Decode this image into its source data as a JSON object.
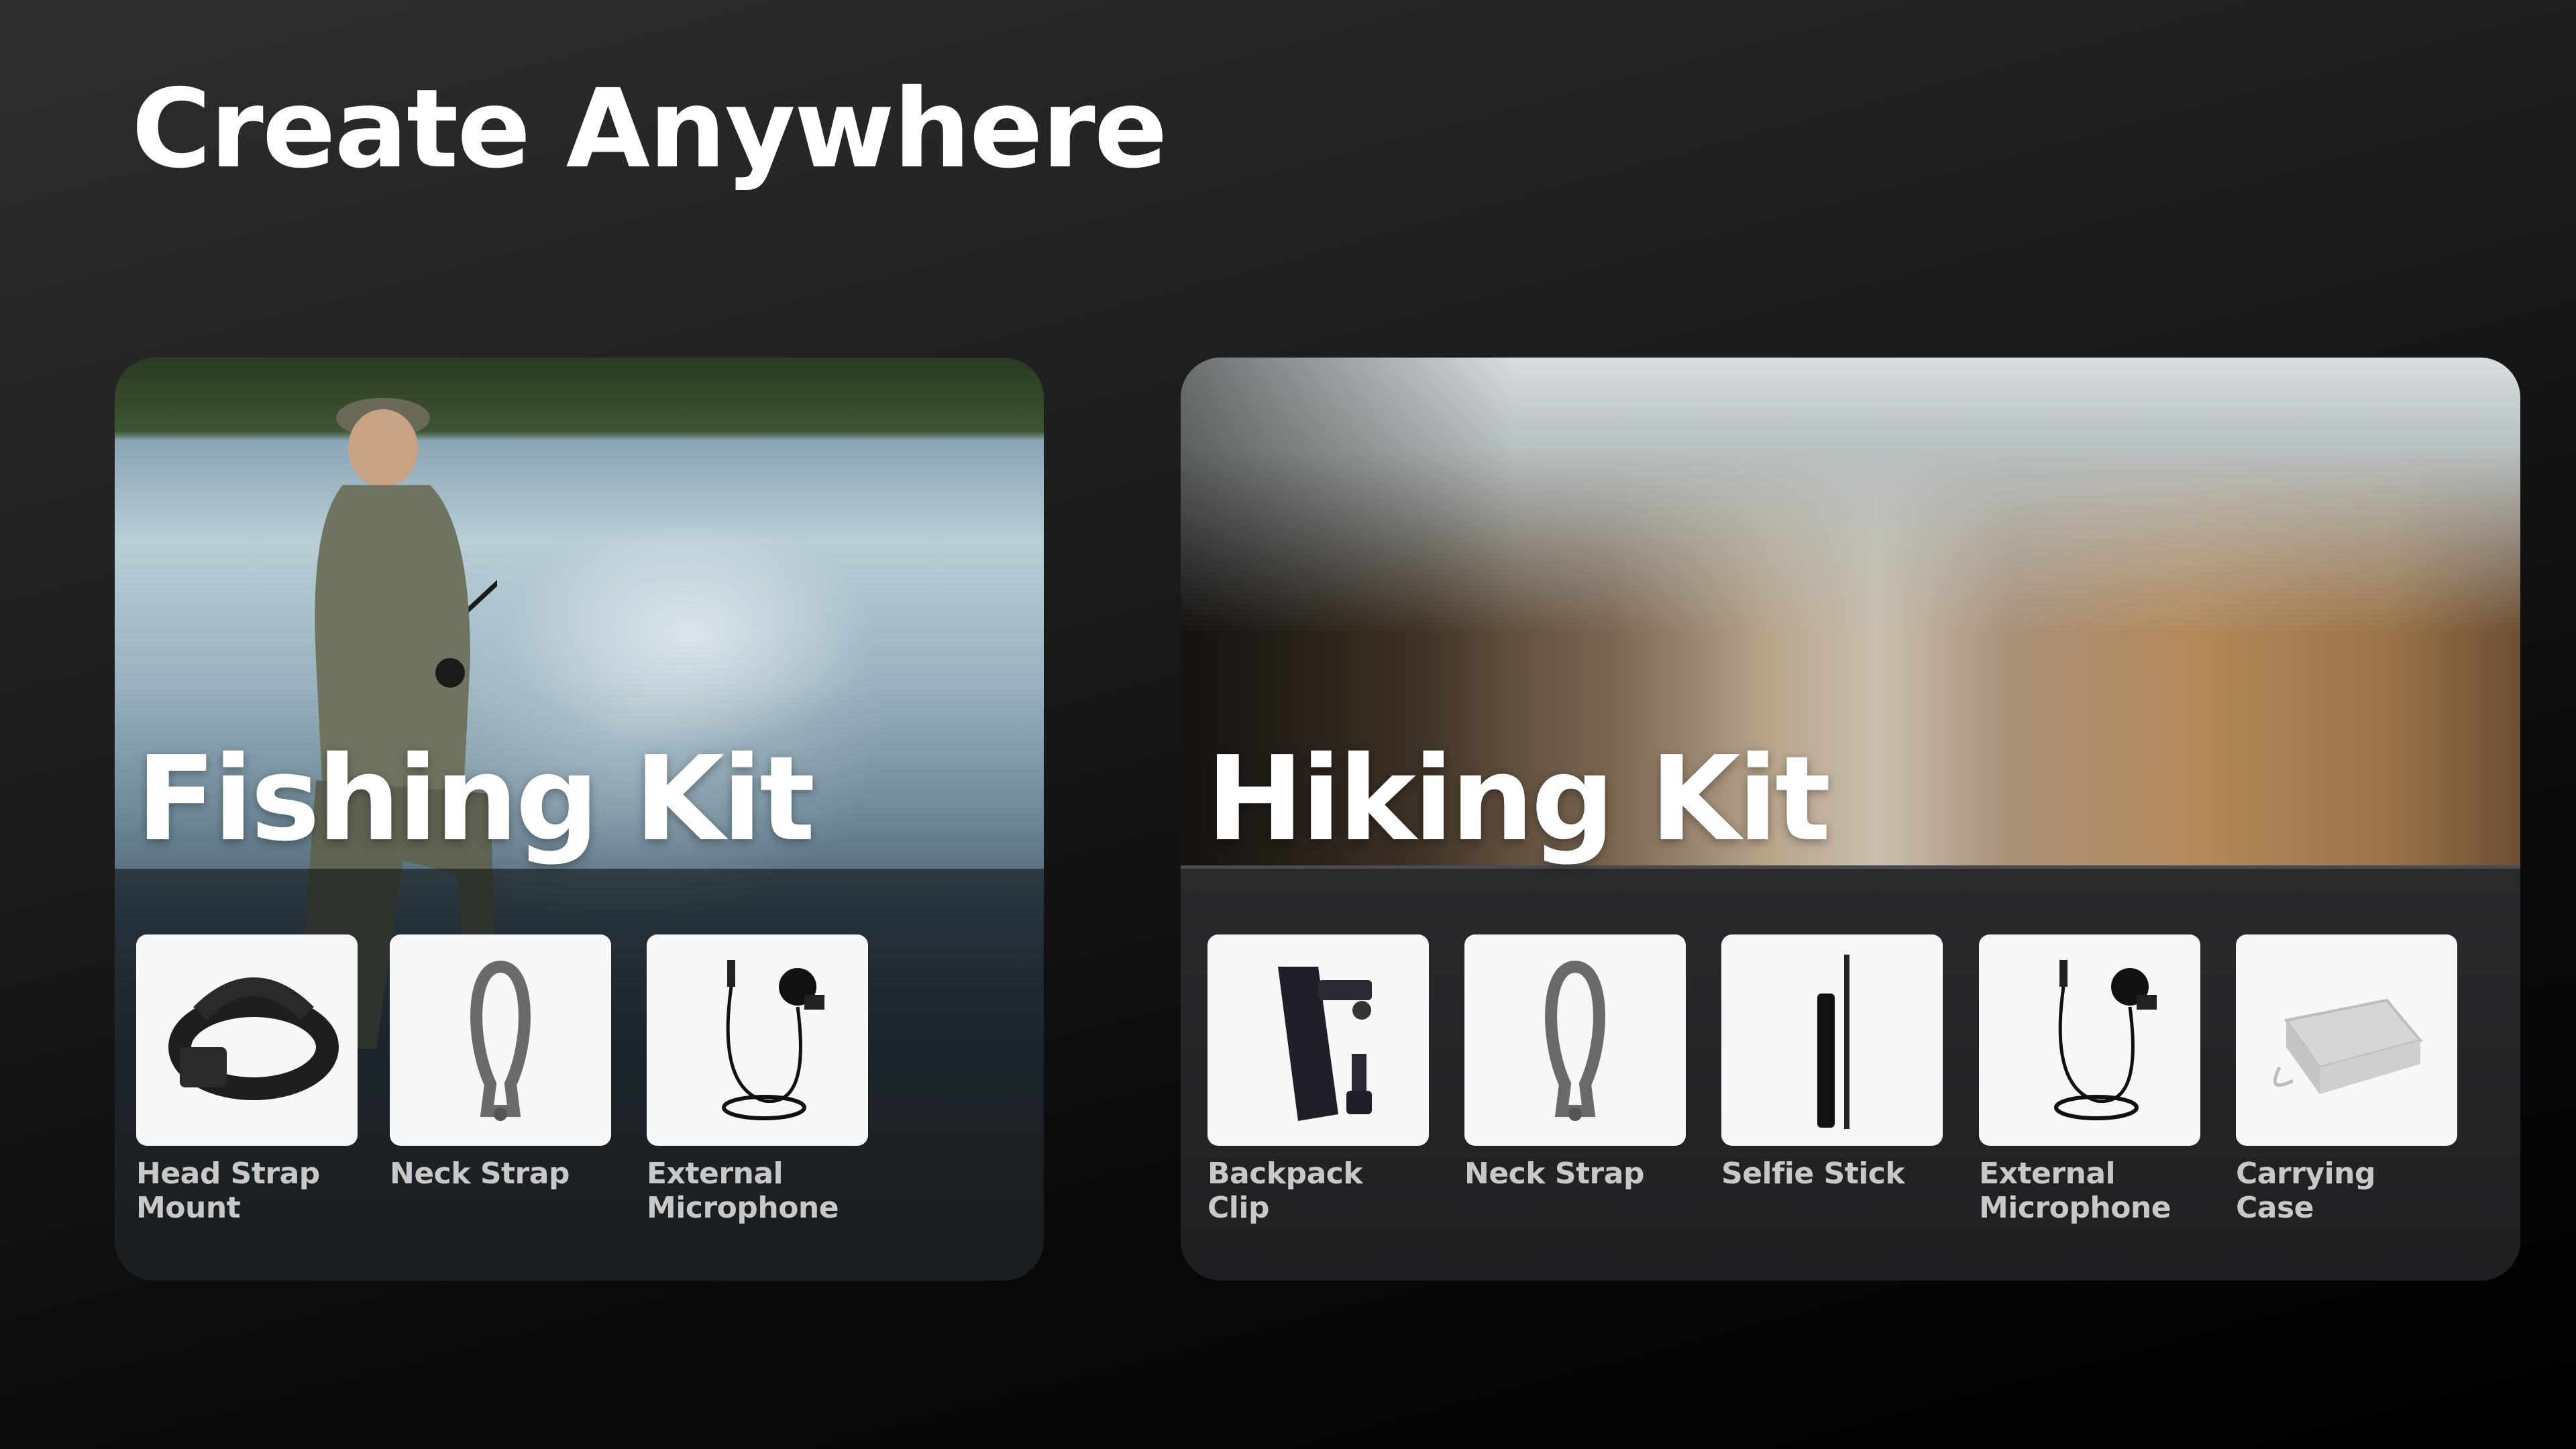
{
  "page": {
    "title": "Create Anywhere"
  },
  "kits": [
    {
      "title": "Fishing Kit",
      "accessories": [
        {
          "label": "Head Strap Mount",
          "icon": "head-strap-icon"
        },
        {
          "label": "Neck Strap",
          "icon": "neck-strap-icon"
        },
        {
          "label": "External Microphone",
          "icon": "microphone-icon"
        }
      ]
    },
    {
      "title": "Hiking Kit",
      "accessories": [
        {
          "label": "Backpack Clip",
          "icon": "backpack-clip-icon"
        },
        {
          "label": "Neck Strap",
          "icon": "neck-strap-icon"
        },
        {
          "label": "Selfie Stick",
          "icon": "selfie-stick-icon"
        },
        {
          "label": "External Microphone",
          "icon": "microphone-icon"
        },
        {
          "label": "Carrying Case",
          "icon": "carrying-case-icon"
        }
      ]
    }
  ]
}
